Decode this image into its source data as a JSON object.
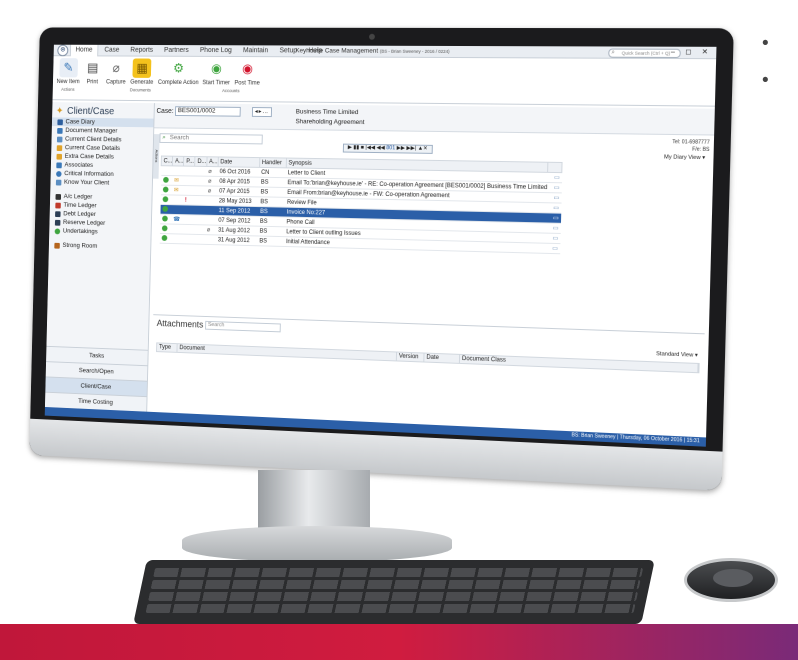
{
  "ribbon": {
    "tabs": [
      "Home",
      "Case",
      "Reports",
      "Partners",
      "Phone Log",
      "Maintain",
      "Setup",
      "Help"
    ],
    "title": "Keyhouse Case Management",
    "title_sub": "(BS - Brian Sweeney - 2016 / 0224)",
    "search_placeholder": "Quick Search (Ctrl + Q)",
    "groups": [
      {
        "label": "Actions",
        "buttons": [
          "New Item"
        ]
      },
      {
        "label": "Documents",
        "buttons": [
          "Print",
          "Capture",
          "Generate",
          "Complete Action"
        ]
      },
      {
        "label": "Accounts",
        "buttons": [
          "Start Timer",
          "Post Time"
        ]
      }
    ]
  },
  "sidebar": {
    "heading": "Client/Case",
    "items_a": [
      "Case Diary",
      "Document Manager",
      "Current Client Details",
      "Current Case Details",
      "Extra Case Details",
      "Associates",
      "Critical Information",
      "Know Your Client"
    ],
    "items_b": [
      "A/c Ledger",
      "Time Ledger",
      "Debt Ledger",
      "Reserve Ledger",
      "Undertakings"
    ],
    "items_c": [
      "Strong Room"
    ],
    "nav": [
      "Tasks",
      "Search/Open",
      "Client/Case",
      "Time Costing"
    ]
  },
  "case": {
    "label": "Case:",
    "value": "BES001/0002",
    "client": "Business Time Limited",
    "matter": "Shareholding Agreement",
    "tel": "Tel: 01-6987777",
    "fe": "F/e: BS"
  },
  "diary": {
    "search_placeholder": "Search",
    "actions_tab": "Actions",
    "player_number": "801",
    "view_label": "My Diary View",
    "columns": [
      "C...",
      "A...",
      "P...",
      "D...",
      "A...",
      "Date",
      "Handler",
      "Synopsis"
    ],
    "rows": [
      {
        "date": "06 Oct 2016",
        "handler": "CN",
        "synopsis": "Letter to Client"
      },
      {
        "date": "08 Apr 2015",
        "handler": "BS",
        "synopsis": "Email To:'brian@keyhouse.ie' - RE: Co-operation Agreement [BES001/0002] Business Time Limited"
      },
      {
        "date": "07 Apr 2015",
        "handler": "BS",
        "synopsis": "Email From:brian@keyhouse.ie - FW: Co-operation Agreement"
      },
      {
        "date": "28 May 2013",
        "handler": "BS",
        "synopsis": "Review File"
      },
      {
        "date": "11 Sep 2012",
        "handler": "BS",
        "synopsis": "Invoice No:227"
      },
      {
        "date": "07 Sep 2012",
        "handler": "BS",
        "synopsis": "Phone Call"
      },
      {
        "date": "31 Aug 2012",
        "handler": "BS",
        "synopsis": "Letter to Client outling Issues"
      },
      {
        "date": "31 Aug 2012",
        "handler": "BS",
        "synopsis": "Initial Attendance"
      }
    ]
  },
  "attachments": {
    "title": "Attachments",
    "search_placeholder": "Search",
    "view_label": "Standard View",
    "columns": [
      "Type",
      "Document",
      "Version",
      "Date",
      "Document Class"
    ]
  },
  "status": "BS: Brian Sweeney | Thursday, 06 October 2016 | 15:31",
  "colors": {
    "accent": "#2b5fa8",
    "highlight": "#d2132c",
    "brand_band_start": "#c0173a",
    "brand_band_end": "#7a2a78"
  }
}
